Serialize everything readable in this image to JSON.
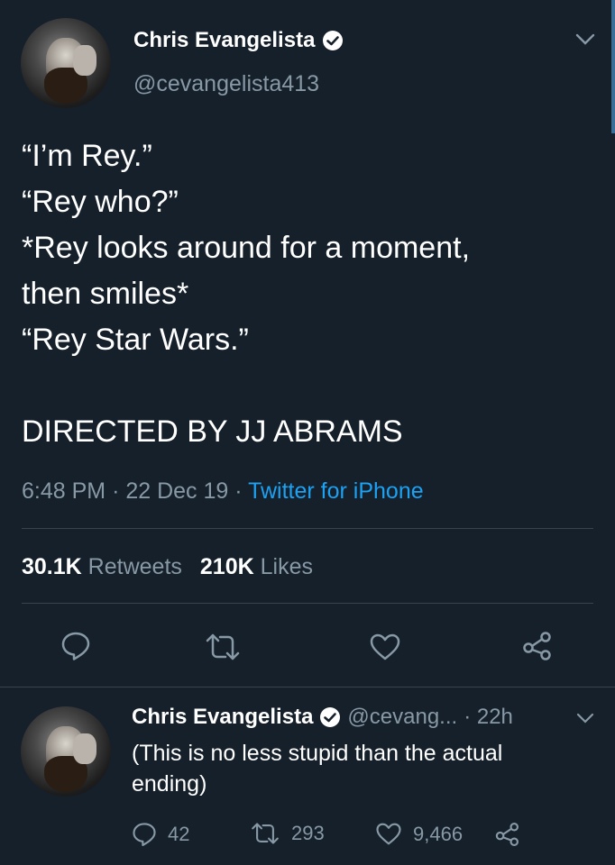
{
  "main_tweet": {
    "author_name": "Chris Evangelista",
    "author_handle": "@cevangelista413",
    "text_lines": [
      "“I’m Rey.”",
      "“Rey who?”",
      "*Rey looks around for a moment,",
      "then smiles*",
      "“Rey Star Wars.”",
      "",
      "DIRECTED BY JJ ABRAMS"
    ],
    "time": "6:48 PM",
    "date": "22 Dec 19",
    "source": "Twitter for iPhone",
    "retweets_count": "30.1K",
    "retweets_label": "Retweets",
    "likes_count": "210K",
    "likes_label": "Likes"
  },
  "reply": {
    "author_name": "Chris Evangelista",
    "author_handle": "@cevang...",
    "age": "· 22h",
    "text": "(This is no less stupid than the actual ending)",
    "reply_count": "42",
    "retweet_count": "293",
    "like_count": "9,466"
  },
  "colors": {
    "background": "#15202b",
    "secondary_text": "#8899a6",
    "link": "#1da1f2",
    "divider": "#38444d"
  },
  "icons": [
    "verified-badge-icon",
    "chevron-down-icon",
    "reply-icon",
    "retweet-icon",
    "like-icon",
    "share-icon"
  ]
}
